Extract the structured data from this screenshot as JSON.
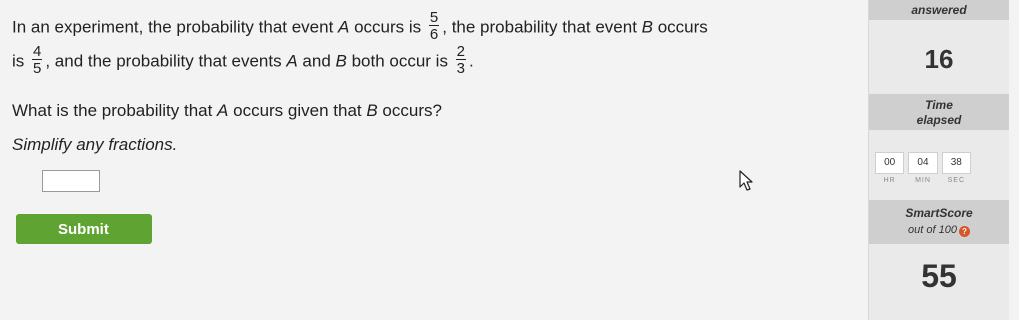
{
  "question": {
    "line1_a": "In an experiment, the probability that event ",
    "event_a": "A",
    "line1_b": " occurs is ",
    "pA_num": "5",
    "pA_den": "6",
    "line1_c": ", the probability that event ",
    "event_b": "B",
    "line1_d": " occurs",
    "line2_a": "is ",
    "pB_num": "4",
    "pB_den": "5",
    "line2_b": ", and the probability that events ",
    "line2_c": " and ",
    "line2_d": " both occur is ",
    "pAB_num": "2",
    "pAB_den": "3",
    "line2_e": ".",
    "line3_a": "What is the probability that ",
    "line3_b": " occurs given that ",
    "line3_c": " occurs?",
    "instruction": "Simplify any fractions."
  },
  "answer": {
    "value": ""
  },
  "submit": {
    "label": "Submit"
  },
  "sidebar": {
    "answered_label": "answered",
    "answered_count": "16",
    "time_label_1": "Time",
    "time_label_2": "elapsed",
    "timer": {
      "hr": "00",
      "min": "04",
      "sec": "38"
    },
    "timer_units": {
      "hr": "HR",
      "min": "MIN",
      "sec": "SEC"
    },
    "smartscore_label": "SmartScore",
    "smartscore_sub": "out of 100",
    "smartscore_value": "55"
  },
  "colors": {
    "submit_bg": "#5fa332",
    "info_icon": "#d9542b"
  },
  "icons": {
    "cursor": "mouse-pointer-icon",
    "info": "info-icon"
  }
}
